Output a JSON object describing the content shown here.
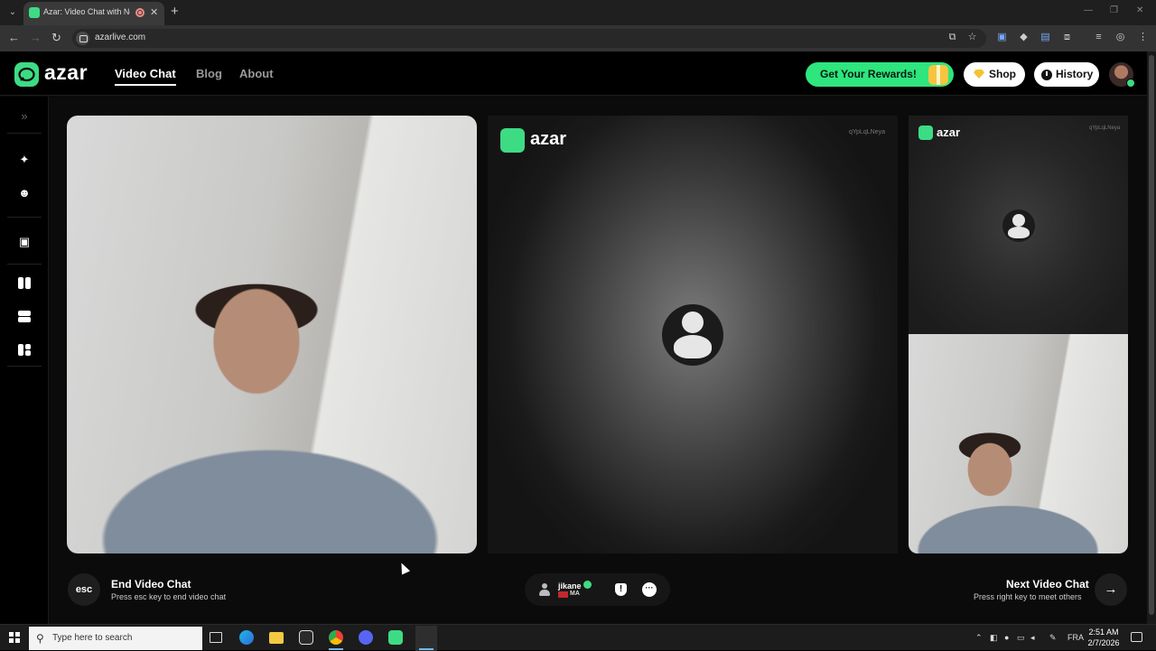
{
  "browser": {
    "tab_title": "Azar: Video Chat with New",
    "url": "azarlive.com"
  },
  "header": {
    "brand": "azar",
    "nav": [
      "Video Chat",
      "Blog",
      "About"
    ],
    "rewards_label": "Get Your Rewards!",
    "shop_label": "Shop",
    "history_label": "History"
  },
  "tiles": {
    "remote_brand": "azar",
    "remote_watermark": "qYpLqLNeya",
    "preview_brand": "azar",
    "preview_watermark": "qYpLqLNeya"
  },
  "controls": {
    "esc_key": "esc",
    "end_title": "End Video Chat",
    "end_sub": "Press esc key to end video chat",
    "peer_name": "jikane",
    "peer_country": "MA",
    "next_title": "Next Video Chat",
    "next_sub": "Press right key to meet others",
    "next_arrow": "→"
  },
  "taskbar": {
    "search_placeholder": "Type here to search",
    "language": "FRA",
    "time": "2:51 AM",
    "date": "2/7/2026"
  },
  "colors": {
    "brand_green": "#3ddc84",
    "rewards_green": "#2ee57e"
  },
  "icons": [
    "sidebar-expand-icon",
    "magic-wand-icon",
    "emoji-icon",
    "sticker-icon",
    "layout-side-by-side-icon",
    "layout-stacked-icon",
    "layout-grid-icon",
    "report-icon",
    "chat-icon",
    "arrow-right-icon"
  ]
}
